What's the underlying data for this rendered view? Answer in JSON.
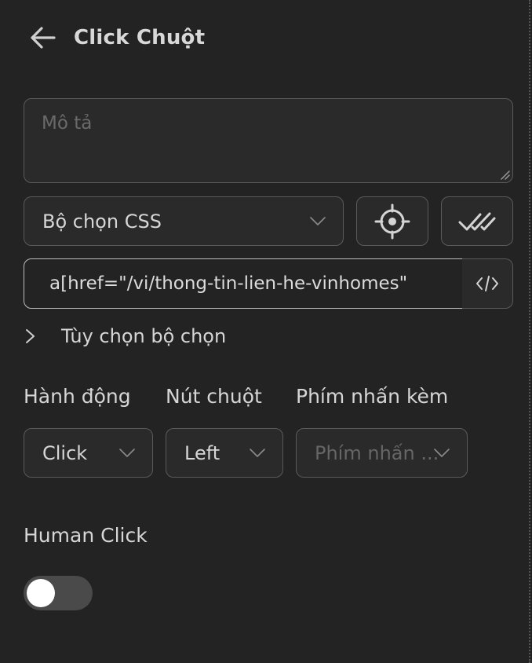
{
  "header": {
    "title": "Click Chuột",
    "back_icon": "arrow-left-icon"
  },
  "description": {
    "placeholder": "Mô tả",
    "value": ""
  },
  "selector": {
    "type_value": "Bộ chọn CSS",
    "picker_icon": "crosshair-icon",
    "verify_icon": "double-check-icon",
    "value": "a[href=\"/vi/thong-tin-lien-he-vinhomes\"",
    "code_icon": "code-icon",
    "options_label": "Tùy chọn bộ chọn"
  },
  "fields": {
    "action_label": "Hành động",
    "action_value": "Click",
    "button_label": "Nút chuột",
    "button_value": "Left",
    "modifier_label": "Phím nhấn kèm",
    "modifier_placeholder": "Phím nhấn ..."
  },
  "human_click": {
    "label": "Human Click",
    "enabled": false
  },
  "colors": {
    "background": "#232323",
    "border": "#5a5a5a",
    "text": "#d6d6d6",
    "placeholder": "#6a6a6a"
  }
}
